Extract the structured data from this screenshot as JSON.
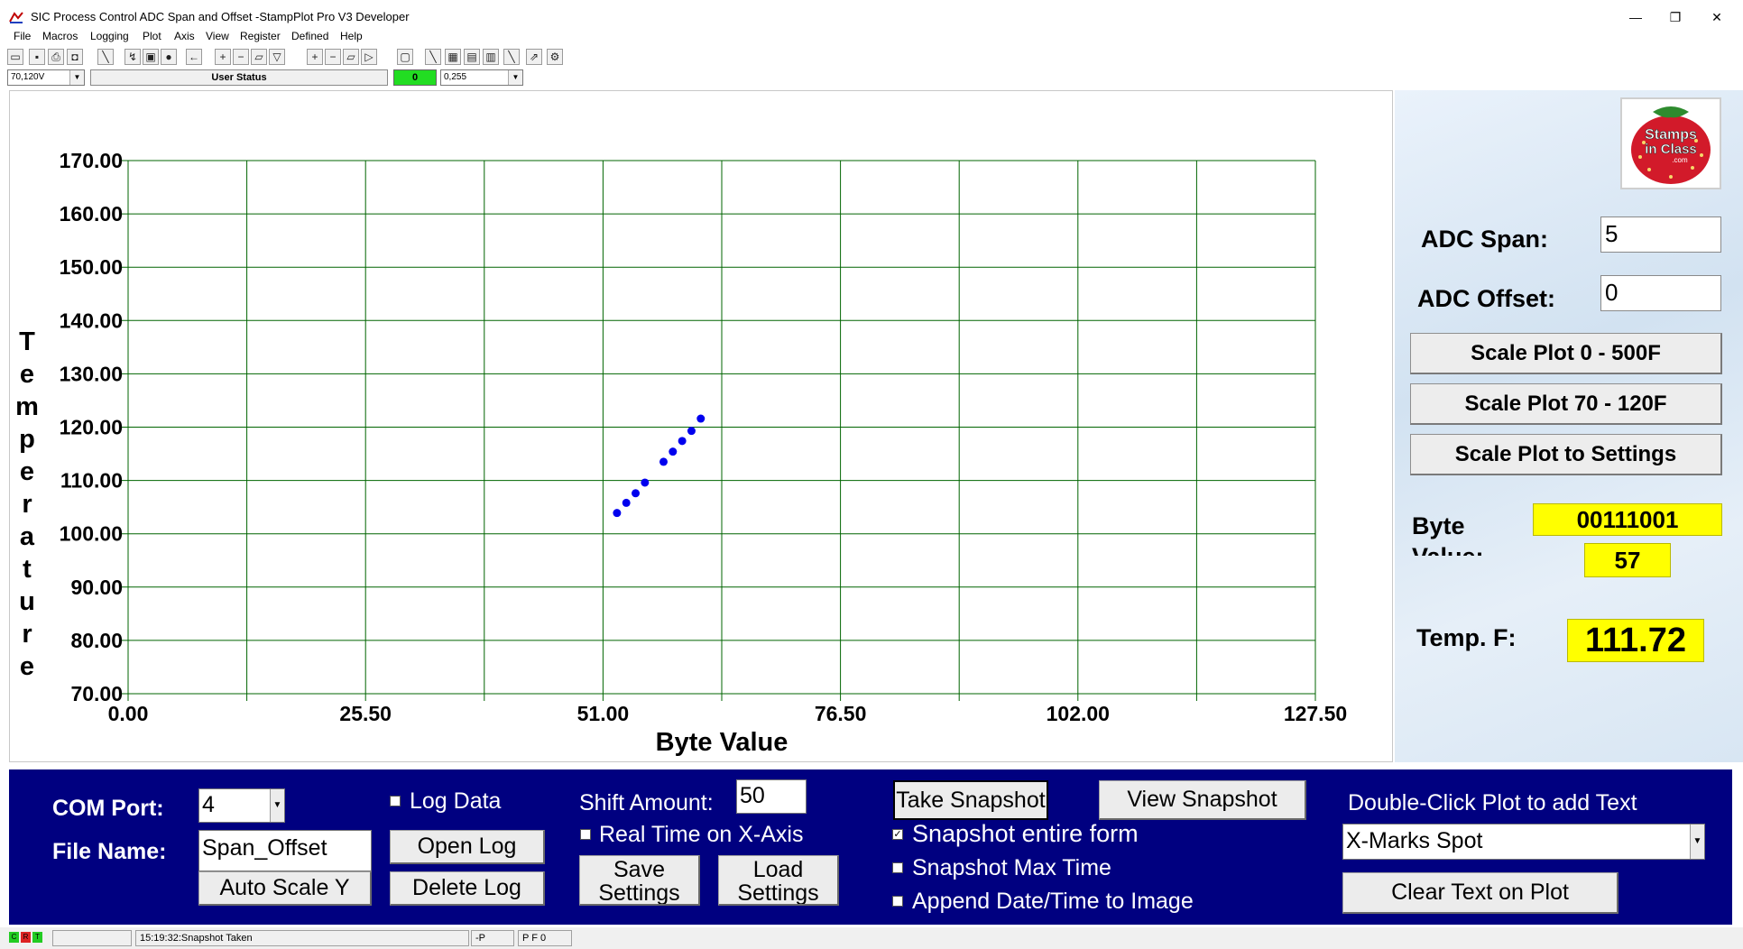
{
  "window": {
    "title": "SIC Process Control ADC Span and Offset -StampPlot Pro V3 Developer",
    "minimize": "—",
    "maximize": "❐",
    "close": "✕"
  },
  "menu": [
    "File",
    "Macros",
    "Logging",
    "Plot",
    "Axis",
    "View",
    "Register",
    "Defined",
    "Help"
  ],
  "status_row": {
    "range_combo": "70,120V",
    "user_status": "User Status",
    "indicator_value": "0",
    "byte_range_combo": "0,255"
  },
  "chart_data": {
    "type": "scatter",
    "xlabel": "Byte Value",
    "ylabel": "Temperature",
    "xlim": [
      0,
      127.5
    ],
    "ylim": [
      70,
      170
    ],
    "x_tick_labels": [
      "0.00",
      "25.50",
      "51.00",
      "76.50",
      "102.00",
      "127.50"
    ],
    "x_ticks": [
      0,
      25.5,
      51,
      76.5,
      102,
      127.5
    ],
    "y_tick_labels": [
      "170.00",
      "160.00",
      "150.00",
      "140.00",
      "130.00",
      "120.00",
      "110.00",
      "100.00",
      "90.00",
      "80.00",
      "70.00"
    ],
    "y_ticks": [
      170,
      160,
      150,
      140,
      130,
      120,
      110,
      100,
      90,
      80,
      70
    ],
    "grid": true,
    "point_color": "#0000ee",
    "grid_color": "#006400",
    "points": [
      {
        "x": 52.5,
        "y": 103.9
      },
      {
        "x": 53.5,
        "y": 105.8
      },
      {
        "x": 54.5,
        "y": 107.6
      },
      {
        "x": 55.5,
        "y": 109.6
      },
      {
        "x": 57.5,
        "y": 113.5
      },
      {
        "x": 58.5,
        "y": 115.4
      },
      {
        "x": 59.5,
        "y": 117.4
      },
      {
        "x": 60.5,
        "y": 119.3
      },
      {
        "x": 61.5,
        "y": 121.6
      }
    ]
  },
  "right_panel": {
    "logo_text": [
      "Stamps",
      "in Class",
      ".com"
    ],
    "adc_span_label": "ADC Span:",
    "adc_span_value": "5",
    "adc_offset_label": "ADC Offset:",
    "adc_offset_value": "0",
    "scale_0_500_button": "Scale Plot 0 - 500F",
    "scale_70_120_button": "Scale Plot 70 - 120F",
    "scale_settings_button": "Scale Plot to Settings",
    "byte_value_label": "Byte Value:",
    "byte_binary": "00111001",
    "byte_decimal": "57",
    "temp_label": "Temp. F:",
    "temp_value": "111.72",
    "accent_yellow": "#ffff00"
  },
  "control_panel": {
    "com_port_label": "COM Port:",
    "com_port_value": "4",
    "file_name_label": "File Name:",
    "file_name_value": "Span_Offset",
    "auto_scale_button": "Auto Scale Y",
    "log_data_label": "Log Data",
    "open_log_button": "Open Log",
    "delete_log_button": "Delete Log",
    "shift_amount_label": "Shift Amount:",
    "shift_amount_value": "50",
    "realtime_label": "Real Time on X-Axis",
    "save_settings_button": [
      "Save",
      "Settings"
    ],
    "load_settings_button": [
      "Load",
      "Settings"
    ],
    "take_snapshot_button": "Take Snapshot",
    "view_snapshot_button": "View Snapshot",
    "snapshot_form_label": "Snapshot entire form",
    "snapshot_form_checked": true,
    "snapshot_max_label": "Snapshot Max Time",
    "append_date_label": "Append Date/Time to Image",
    "double_click_label": "Double-Click Plot to add Text",
    "text_select_value": "X-Marks Spot",
    "clear_text_button": "Clear Text on Plot",
    "panel_color": "#000080"
  },
  "statusbar": {
    "leds": [
      "C",
      "R",
      "T"
    ],
    "message": "15:19:32:Snapshot Taken",
    "mode": "-P",
    "flags": "P F 0"
  }
}
